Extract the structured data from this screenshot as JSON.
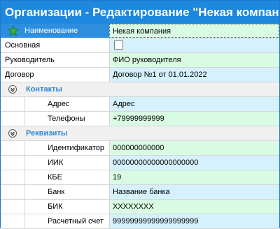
{
  "window": {
    "title": "Организации - Редактирование \"Некая компания\""
  },
  "fields": {
    "name": {
      "label": "Наименование",
      "value": "Некая компания"
    },
    "main": {
      "label": "Основная",
      "checked": false
    },
    "director": {
      "label": "Руководитель",
      "value": "ФИО руководителя"
    },
    "contract": {
      "label": "Договор",
      "value": "Договор №1 от 01.01.2022"
    }
  },
  "contacts": {
    "title": "Контакты",
    "address": {
      "label": "Адрес",
      "value": "Адрес"
    },
    "phones": {
      "label": "Телефоны",
      "value": "+79999999999"
    }
  },
  "requisites": {
    "title": "Реквизиты",
    "identifier": {
      "label": "Идентификатор",
      "value": "000000000000"
    },
    "iik": {
      "label": "ИИК",
      "value": "00000000000000000000"
    },
    "kbe": {
      "label": "КБЕ",
      "value": "19"
    },
    "bank": {
      "label": "Банк",
      "value": "Название банка"
    },
    "bik": {
      "label": "БИК",
      "value": "XXXXXXXX"
    },
    "account": {
      "label": "Расчетный счет",
      "value": "99999999999999999999"
    }
  },
  "colors": {
    "titlebar": "#1e87de",
    "selected": "#2d8ee0",
    "green_row": "#d9fbe3",
    "blue_row": "#d4f1fd",
    "group_label": "#2e86d4"
  },
  "icons": {
    "required_field": "star-icon",
    "group_toggle": "collapse-icon"
  }
}
